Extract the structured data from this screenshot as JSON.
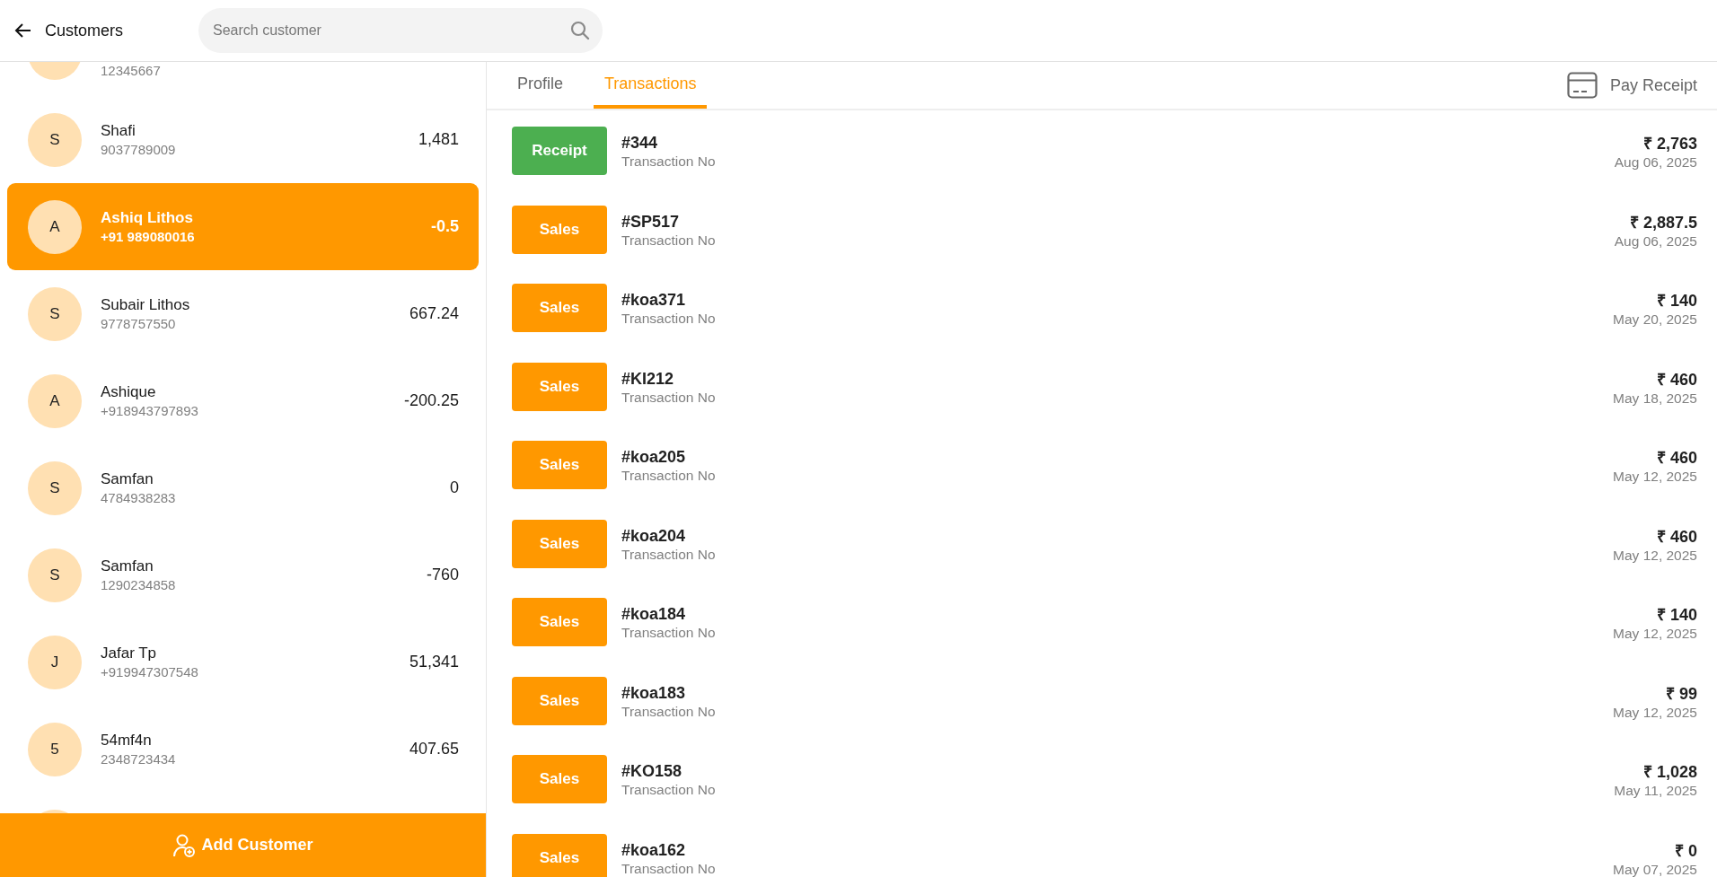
{
  "header": {
    "title": "Customers",
    "search": {
      "placeholder": "Search customer"
    }
  },
  "customers": [
    {
      "phone": "12345667",
      "selected": false
    },
    {
      "initial": "S",
      "name": "Shafi",
      "phone": "9037789009",
      "balance": "1,481",
      "selected": false
    },
    {
      "initial": "A",
      "name": "Ashiq Lithos",
      "phone": "+91 989080016",
      "balance": "-0.5",
      "selected": true
    },
    {
      "initial": "S",
      "name": "Subair Lithos",
      "phone": "9778757550",
      "balance": "667.24",
      "selected": false
    },
    {
      "initial": "A",
      "name": "Ashique",
      "phone": "+918943797893",
      "balance": "-200.25",
      "selected": false
    },
    {
      "initial": "S",
      "name": "Samfan",
      "phone": "4784938283",
      "balance": "0",
      "selected": false
    },
    {
      "initial": "S",
      "name": "Samfan",
      "phone": "1290234858",
      "balance": "-760",
      "selected": false
    },
    {
      "initial": "J",
      "name": "Jafar Tp",
      "phone": "+919947307548",
      "balance": "51,341",
      "selected": false
    },
    {
      "initial": "5",
      "name": "54mf4n",
      "phone": "2348723434",
      "balance": "407.65",
      "selected": false
    },
    {
      "selected": false
    }
  ],
  "add_customer": "Add Customer",
  "tabs": [
    {
      "label": "Profile",
      "selected": false
    },
    {
      "label": "Transactions",
      "selected": true
    }
  ],
  "pay_receipt": "Pay Receipt",
  "transactions": [
    {
      "kind": "receipt",
      "type": "Receipt",
      "number": "#344",
      "caption": "Transaction No",
      "amount": "₹ 2,763",
      "date": "Aug 06, 2025"
    },
    {
      "kind": "sales",
      "type": "Sales",
      "number": "#SP517",
      "caption": "Transaction No",
      "amount": "₹ 2,887.5",
      "date": "Aug 06, 2025"
    },
    {
      "kind": "sales",
      "type": "Sales",
      "number": "#koa371",
      "caption": "Transaction No",
      "amount": "₹ 140",
      "date": "May 20, 2025"
    },
    {
      "kind": "sales",
      "type": "Sales",
      "number": "#KI212",
      "caption": "Transaction No",
      "amount": "₹ 460",
      "date": "May 18, 2025"
    },
    {
      "kind": "sales",
      "type": "Sales",
      "number": "#koa205",
      "caption": "Transaction No",
      "amount": "₹ 460",
      "date": "May 12, 2025"
    },
    {
      "kind": "sales",
      "type": "Sales",
      "number": "#koa204",
      "caption": "Transaction No",
      "amount": "₹ 460",
      "date": "May 12, 2025"
    },
    {
      "kind": "sales",
      "type": "Sales",
      "number": "#koa184",
      "caption": "Transaction No",
      "amount": "₹ 140",
      "date": "May 12, 2025"
    },
    {
      "kind": "sales",
      "type": "Sales",
      "number": "#koa183",
      "caption": "Transaction No",
      "amount": "₹ 99",
      "date": "May 12, 2025"
    },
    {
      "kind": "sales",
      "type": "Sales",
      "number": "#KO158",
      "caption": "Transaction No",
      "amount": "₹ 1,028",
      "date": "May 11, 2025"
    },
    {
      "kind": "sales",
      "type": "Sales",
      "number": "#koa162",
      "caption": "Transaction No",
      "amount": "₹ 0",
      "date": "May 07, 2025"
    }
  ]
}
